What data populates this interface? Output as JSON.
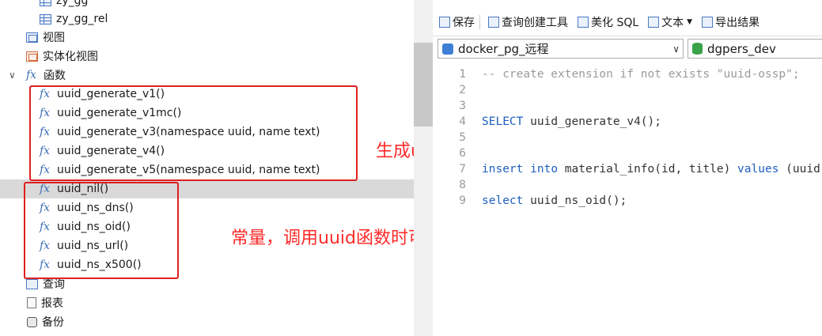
{
  "navigator": {
    "tables": [
      "zy_gg",
      "zy_gg_rel"
    ],
    "views_label": "视图",
    "mviews_label": "实体化视图",
    "functions_label": "函数",
    "functions": [
      "uuid_generate_v1()",
      "uuid_generate_v1mc()",
      "uuid_generate_v3(namespace uuid, name text)",
      "uuid_generate_v4()",
      "uuid_generate_v5(namespace uuid, name text)",
      "uuid_nil()",
      "uuid_ns_dns()",
      "uuid_ns_oid()",
      "uuid_ns_url()",
      "uuid_ns_x500()"
    ],
    "fx_glyph": "fx",
    "queries_label": "查询",
    "reports_label": "报表",
    "backup_label": "备份"
  },
  "annotations": {
    "generator_note": "生成uuid的函数",
    "constant_note": "常量，调用uuid函数时可作为入参",
    "color": "#ff2a2a"
  },
  "toolbar": {
    "save": "保存",
    "query_builder": "查询创建工具",
    "beautify": "美化 SQL",
    "text": "文本",
    "export": "导出结果"
  },
  "connection": {
    "name": "docker_pg_远程"
  },
  "database": {
    "name": "dgpers_dev"
  },
  "editor": {
    "lines": [
      {
        "n": "1",
        "text": "-- create extension if not exists \"uuid-ossp\";"
      },
      {
        "n": "2",
        "text": ""
      },
      {
        "n": "3",
        "text": ""
      },
      {
        "n": "4",
        "text": "SELECT uuid_generate_v4();"
      },
      {
        "n": "5",
        "text": ""
      },
      {
        "n": "6",
        "text": ""
      },
      {
        "n": "7",
        "text": "insert into material_info(id, title) values (uuid"
      },
      {
        "n": "8",
        "text": ""
      },
      {
        "n": "9",
        "text": "select uuid_ns_oid();"
      }
    ]
  }
}
